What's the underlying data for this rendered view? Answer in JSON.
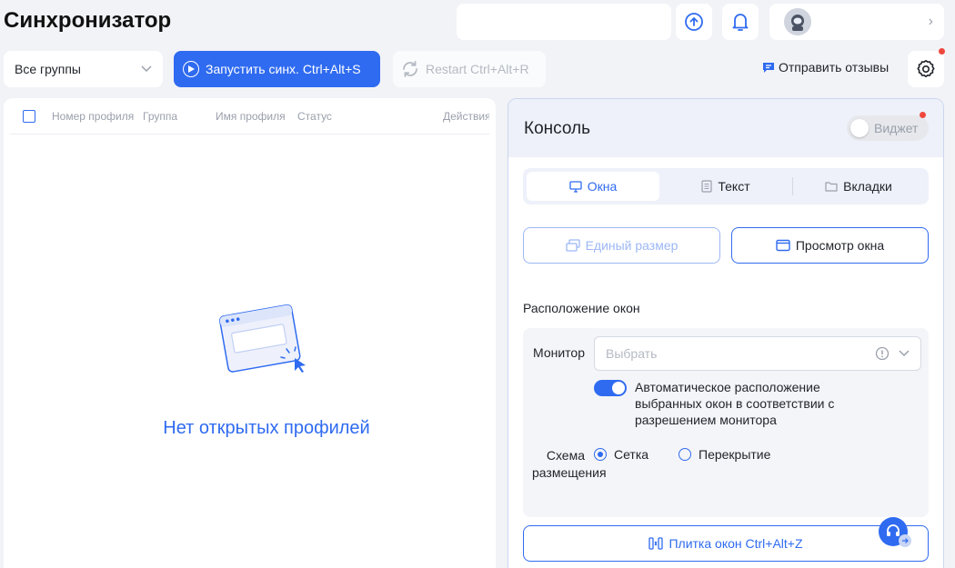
{
  "app": {
    "title": "Синхронизатор"
  },
  "header": {
    "account_chevron": "›"
  },
  "toolbar": {
    "group_select": "Все группы",
    "start_sync": "Запустить синх. Ctrl+Alt+S",
    "restart": "Restart Ctrl+Alt+R",
    "feedback": "Отправить отзывы"
  },
  "table": {
    "columns": [
      "Номер профиля",
      "Группа",
      "Имя профиля",
      "Статус",
      "Действия"
    ],
    "empty_text": "Нет открытых профилей"
  },
  "console": {
    "title": "Консоль",
    "widget_label": "Виджет",
    "tabs": [
      {
        "label": "Окна",
        "icon": "monitor-icon",
        "active": true
      },
      {
        "label": "Текст",
        "icon": "document-icon",
        "active": false
      },
      {
        "label": "Вкладки",
        "icon": "folder-icon",
        "active": false
      }
    ],
    "uniform_size": "Единый размер",
    "window_preview": "Просмотр окна",
    "arrangement_title": "Расположение окон",
    "monitor_label": "Монитор",
    "monitor_placeholder": "Выбрать",
    "auto_arrange_text": "Автоматическое расположение выбранных окон в соответствии с разрешением монитора",
    "auto_arrange_on": true,
    "layout_label": "Схема размещения",
    "layout_options": [
      {
        "label": "Сетка",
        "selected": true
      },
      {
        "label": "Перекрытие",
        "selected": false
      }
    ],
    "tile_windows": "Плитка окон Ctrl+Alt+Z"
  },
  "colors": {
    "accent": "#2f6bf0",
    "notification": "#f0483e"
  }
}
